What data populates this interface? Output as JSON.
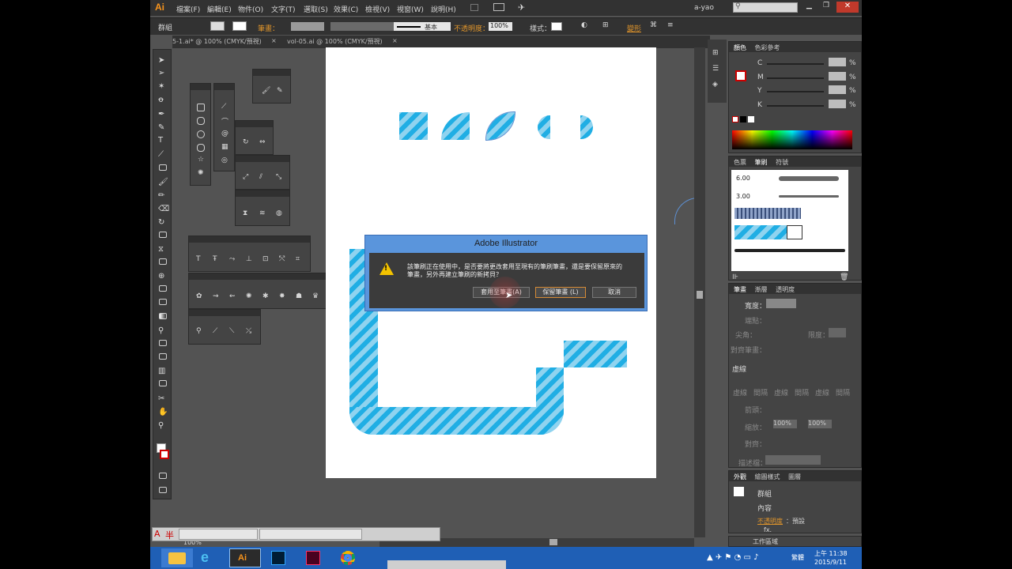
{
  "app": {
    "logo": "Ai",
    "accent": "#f7941d",
    "user": "a-yao"
  },
  "menu": [
    "檔案(F)",
    "編輯(E)",
    "物件(O)",
    "文字(T)",
    "選取(S)",
    "效果(C)",
    "檢視(V)",
    "視窗(W)",
    "說明(H)"
  ],
  "control_bar": {
    "selection_label": "群組",
    "stroke_label": "筆畫：",
    "brush_name": "基本",
    "opacity_label": "不透明度：",
    "opacity_value": "100%",
    "style_label": "樣式：",
    "transform_label": "變形"
  },
  "doc_tabs": [
    {
      "label": "5-1.ai* @ 100% (CMYK/預視)",
      "close": "×"
    },
    {
      "label": "vol-05.ai @ 100% (CMYK/預視)",
      "close": "×"
    }
  ],
  "color_panel": {
    "tabs": [
      "顏色",
      "色彩參考"
    ],
    "channels": [
      {
        "label": "C",
        "unit": "%"
      },
      {
        "label": "M",
        "unit": "%"
      },
      {
        "label": "Y",
        "unit": "%"
      },
      {
        "label": "K",
        "unit": "%"
      }
    ]
  },
  "brush_panel": {
    "tabs": [
      "色票",
      "筆刷",
      "符號"
    ],
    "brushes": [
      {
        "size": "6.00"
      },
      {
        "size": "3.00"
      }
    ]
  },
  "stroke_panel": {
    "tabs": [
      "筆畫",
      "漸層",
      "透明度"
    ],
    "width_label": "寬度：",
    "cap_label": "端點：",
    "corner_label": "尖角：",
    "limit_label": "限度：",
    "align_label": "對齊筆畫：",
    "dashed_label": "虛線",
    "dash_fields": [
      "虛線",
      "間隔",
      "虛線",
      "間隔",
      "虛線",
      "間隔"
    ],
    "arrow_label": "箭頭：",
    "scale_label": "縮放：",
    "scale_values": [
      "100%",
      "100%"
    ],
    "align2_label": "對齊：",
    "profile_label": "描述檔："
  },
  "appearance_panel": {
    "tabs": [
      "外觀",
      "繪圖樣式",
      "圖層"
    ],
    "group_label": "群組",
    "content_label": "內容",
    "opacity_label": "不透明度",
    "opacity_value": "：預設",
    "fx": "fx."
  },
  "bottom_panel": {
    "tab": "工作區域"
  },
  "zoom": "100%",
  "dialog": {
    "title": "Adobe Illustrator",
    "message_line1": "該筆刷正在使用中，是否要將更改套用至現有的筆刷筆畫，還是要保留原來的",
    "message_line2": "筆畫，另外再建立筆刷的新拷貝？",
    "apply_button": "套用至筆畫(A)",
    "keep_button": "保留筆畫 (L)",
    "cancel_button": "取消"
  },
  "ime": {
    "label_a": "A",
    "label_b": "半"
  },
  "taskbar": {
    "time": "上午 11:38",
    "date": "2015/9/11",
    "lang": "繁體"
  }
}
